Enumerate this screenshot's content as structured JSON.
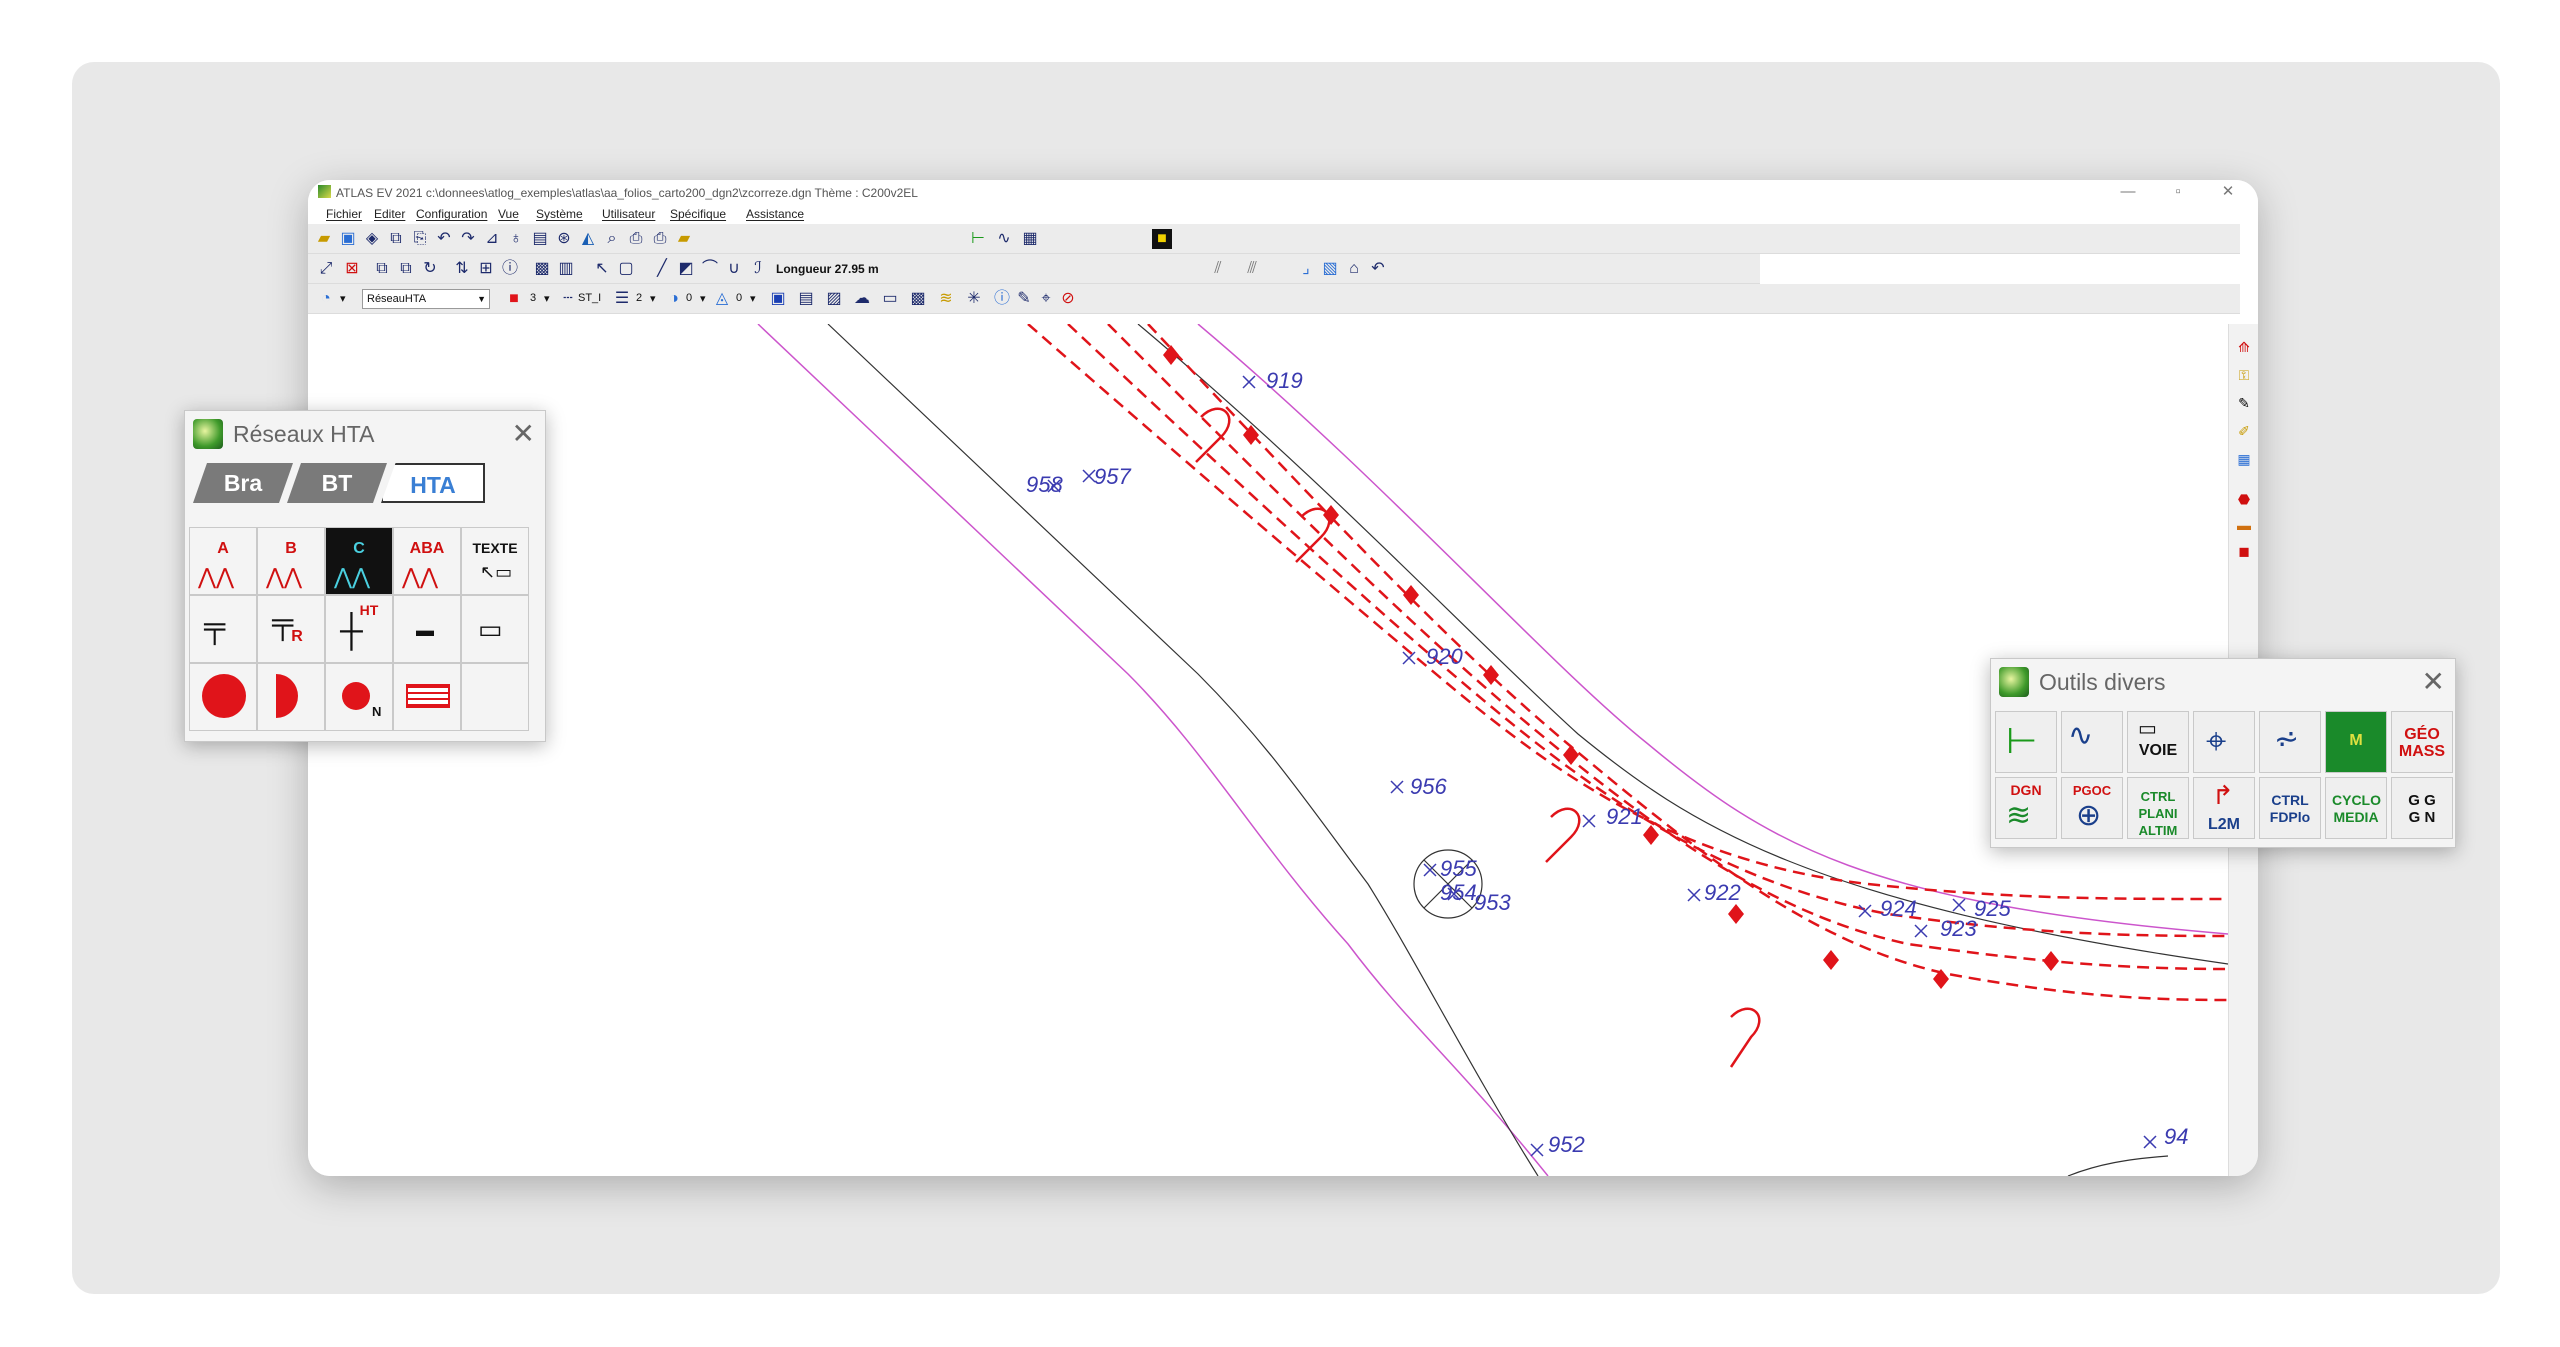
{
  "window": {
    "title": "ATLAS EV 2021 c:\\donnees\\atlog_exemples\\atlas\\aa_folios_carto200_dgn2\\zcorreze.dgn Thème : C200v2EL",
    "controls": {
      "minimize": "—",
      "maximize": "▫",
      "close": "✕"
    }
  },
  "menu": [
    "Fichier",
    "Editer",
    "Configuration",
    "Vue",
    "Système",
    "Utilisateur",
    "Spécifique",
    "Assistance"
  ],
  "toolbar": {
    "length_readout": "Longueur 27.95 m",
    "layer_combo": "RéseauHTA",
    "color_value": "3",
    "style_combo": "ST_I",
    "weight_value": "2",
    "fill_value": "0",
    "transp_value": "0"
  },
  "palette_hta": {
    "title": "Réseaux HTA",
    "tabs": [
      "Bra",
      "BT",
      "HTA"
    ],
    "active_tab": "HTA",
    "cells": [
      {
        "label": "A",
        "icon": "line-a-icon"
      },
      {
        "label": "B",
        "icon": "line-b-icon"
      },
      {
        "label": "C",
        "icon": "line-c-icon"
      },
      {
        "label": "ABA",
        "icon": "line-aba-icon"
      },
      {
        "label": "TEXTE",
        "icon": "text-icon"
      },
      {
        "label": "",
        "icon": "pole-icon"
      },
      {
        "label": "R",
        "icon": "pole-r-icon"
      },
      {
        "label": "HT",
        "icon": "pole-ht-icon"
      },
      {
        "label": "",
        "icon": "small-rect-icon"
      },
      {
        "label": "",
        "icon": "rect-icon"
      },
      {
        "label": "",
        "icon": "red-circle-icon"
      },
      {
        "label": "",
        "icon": "half-circle-icon"
      },
      {
        "label": "N",
        "icon": "node-n-icon"
      },
      {
        "label": "",
        "icon": "box-icon"
      },
      {
        "label": "",
        "icon": "empty-icon"
      }
    ]
  },
  "palette_outils": {
    "title": "Outils divers",
    "row1": [
      "",
      "",
      "VOIE",
      "",
      "",
      "M",
      "GÉO MASS"
    ],
    "row2": [
      "DGN",
      "PGOC",
      "CTRL PLANI ALTIM",
      "L2M",
      "CTRL FDPlo",
      "CYCLO MEDIA",
      "G G G N"
    ]
  },
  "map_labels": {
    "points": [
      "919",
      "920",
      "921",
      "922",
      "923",
      "924",
      "925",
      "952",
      "953",
      "954",
      "955",
      "956",
      "957",
      "958",
      "94"
    ]
  },
  "colors": {
    "network_red": "#e0141a",
    "magenta_line": "#cc55cc",
    "label_blue": "#3b3bb0",
    "tab_blue": "#3a7fd4"
  }
}
